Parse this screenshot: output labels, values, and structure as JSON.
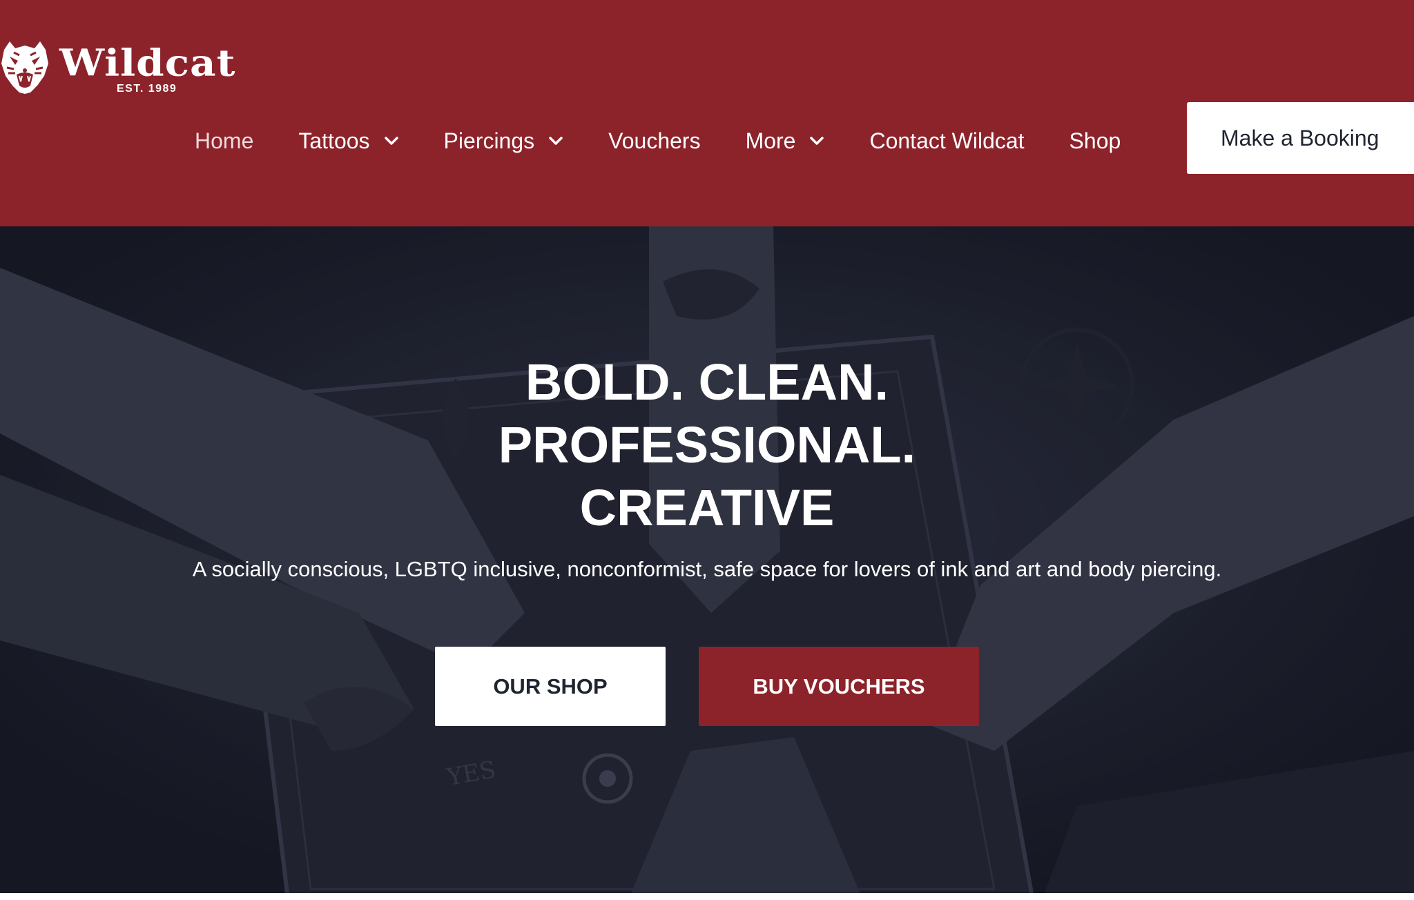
{
  "brand": {
    "name": "Wildcat",
    "est": "EST. 1989",
    "logo_icon": "tiger-head-icon",
    "color": "#8c232b"
  },
  "nav": {
    "items": [
      {
        "label": "Home",
        "has_dropdown": false
      },
      {
        "label": "Tattoos",
        "has_dropdown": true
      },
      {
        "label": "Piercings",
        "has_dropdown": true
      },
      {
        "label": "Vouchers",
        "has_dropdown": false
      },
      {
        "label": "More",
        "has_dropdown": true
      },
      {
        "label": "Contact Wildcat",
        "has_dropdown": false
      },
      {
        "label": "Shop",
        "has_dropdown": false
      }
    ],
    "dropdown_icon": "chevron-down-icon",
    "cta_label": "Make a Booking"
  },
  "hero": {
    "title": "BOLD. CLEAN.\nPROFESSIONAL.\nCREATIVE",
    "subtitle": "A socially conscious, LGBTQ inclusive, nonconformist, safe space for lovers of ink and art and body piercing.",
    "primary_button": "OUR SHOP",
    "secondary_button": "BUY VOUCHERS"
  },
  "colors": {
    "header_bg": "#8c232b",
    "accent": "#8c232b",
    "hero_bg": "#1d1f29",
    "text_light": "#ffffff",
    "text_dark": "#1f2430"
  }
}
